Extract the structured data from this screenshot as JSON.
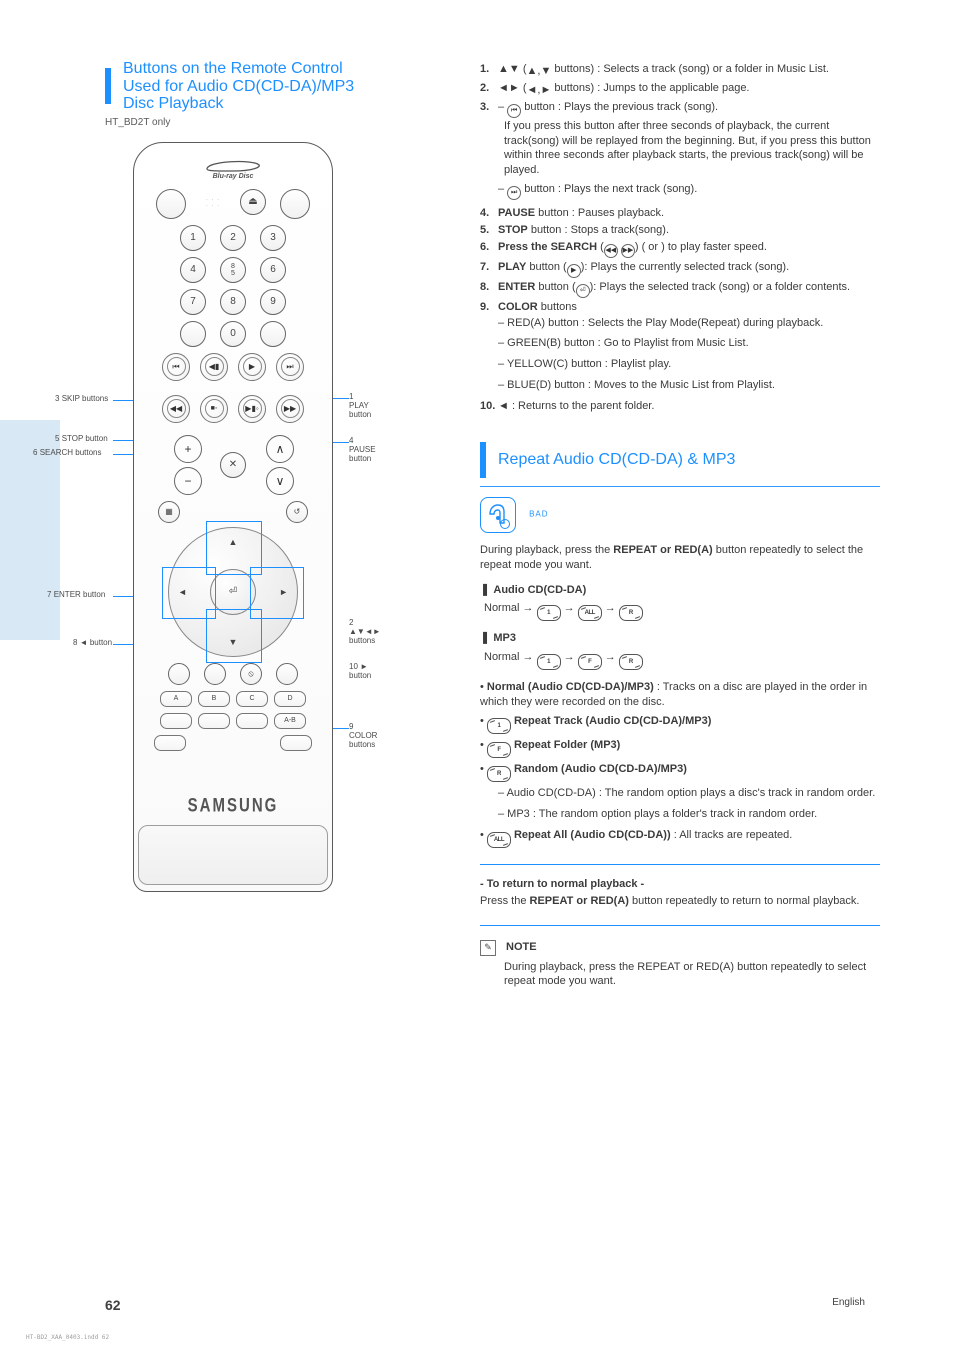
{
  "page": {
    "number": "62",
    "footer_right": "English"
  },
  "corner_code": "HT-BD2_XAA_0403.indd   62",
  "left": {
    "heading_line1": "Buttons on the Remote Control",
    "heading_line2": "Used for Audio CD(CD-DA)/MP3",
    "heading_line3": "Disc Playback",
    "sub": "HT_BD2T only"
  },
  "labels": {
    "left1": {
      "num": "3",
      "txt": "SKIP buttons"
    },
    "left2": {
      "num": "5",
      "txt": "STOP button"
    },
    "left3": {
      "num": "6",
      "txt": "SEARCH buttons"
    },
    "left4": {
      "num": "7",
      "txt": "ENTER button"
    },
    "left5": {
      "num": "8",
      "txt": " button"
    },
    "right1": {
      "num": "1",
      "txt": "PLAY button"
    },
    "right2": {
      "num": "4",
      "txt": "PAUSE button"
    },
    "right3": {
      "num": "2",
      "txt": " buttons"
    },
    "right4": {
      "num": "9",
      "txt": "COLOR buttons"
    },
    "right5": {
      "num": "10",
      "txt": " button"
    }
  },
  "right_steps": {
    "s1": {
      "num": "1.",
      "kw": "▲▼ (",
      "hint": " buttons)",
      "txt": " : Selects a track (song) or a folder in Music List."
    },
    "s2": {
      "num": "2.",
      "kw": "◄► (",
      "hint": " buttons)",
      "txt": " : Jumps to the applicable page."
    },
    "s3": {
      "num": "3.",
      "pref": "– ",
      "btn": " button : Plays the previous track (song).",
      "bullets": [
        "If you press this button after three seconds of playback, the current track(song) will be replayed from the beginning. But, if you press this button within three seconds after playback starts, the previous track(song) will be played."
      ],
      "btn2": " button : Plays the next track (song)."
    },
    "s4": {
      "num": "4.",
      "kw": "PAUSE",
      "txt": " button : Pauses playback."
    },
    "s5": {
      "num": "5.",
      "kw": "STOP",
      "txt": " button : Stops a track(song)."
    },
    "s6": {
      "num": "6.",
      "kw": "Press the SEARCH",
      "txt": "(    or    ) to play faster speed."
    },
    "s7": {
      "num": "7.",
      "kw": "PLAY",
      "txt": " button (",
      "tail": "): Plays the currently selected track (song)."
    },
    "s8": {
      "num": "8.",
      "kw": "ENTER",
      "txt": " button (",
      "tail": "): Plays the selected track (song) or a folder contents."
    },
    "s9": {
      "num": "9.",
      "kw": "COLOR",
      "txt": " buttons"
    },
    "s9_red": "– RED(A) button : Selects the Play Mode(Repeat) during playback.",
    "s9_green": "– GREEN(B) button : Go to Playlist from Music List.",
    "s9_yellow": "– YELLOW(C) button : Playlist play.",
    "s9_blue": "– BLUE(D) button : Moves to the Music List from Playlist.",
    "s10": {
      "num": "10.",
      "kw": "◄",
      "txt": " : Returns to the parent folder."
    }
  },
  "repeat": {
    "title": "Repeat Audio CD(CD-DA) & MP3",
    "disc_label": "BAD",
    "line1": "During playback, press the ",
    "line1_kw": "REPEAT or RED(A)",
    "line1_tail": " button repeatedly to select the repeat mode you want.",
    "cd_head": "Audio CD(CD-DA)",
    "cd_seq_leading": "Normal",
    "mp3_head": "MP3",
    "mp3_seq_leading": "Normal",
    "normal_lbl": "Normal (Audio CD(CD-DA)/MP3)",
    "normal_txt": ": Tracks on a disc are played in the order in which they were recorded on the disc.",
    "rep_track_lbl": "Repeat Track (Audio CD(CD-DA)/MP3)",
    "rep_folder_lbl": "Repeat Folder (MP3)",
    "rep_random_lbl": "Random (Audio CD(CD-DA)/MP3)",
    "rep_random_cd": "– Audio CD(CD-DA) : The random option plays a disc's track in random order.",
    "rep_random_mp3": "– MP3 : The random option plays a folder's track in random order.",
    "rep_all_lbl": "Repeat All (Audio CD(CD-DA))",
    "rep_all_txt": ": All tracks are repeated.",
    "return_line1": "- To return to normal playback -",
    "return_line2_pre": "Press the ",
    "return_line2_kw": "REPEAT or RED(A)",
    "return_line2_tail": " button repeatedly to return to normal playback."
  },
  "rm_icons": {
    "track": "1",
    "all": "ALL",
    "rand": "R",
    "folder": "F"
  },
  "note": {
    "label": "NOTE",
    "txt": "During playback, press the REPEAT or RED(A) button repeatedly to select repeat mode you want."
  }
}
